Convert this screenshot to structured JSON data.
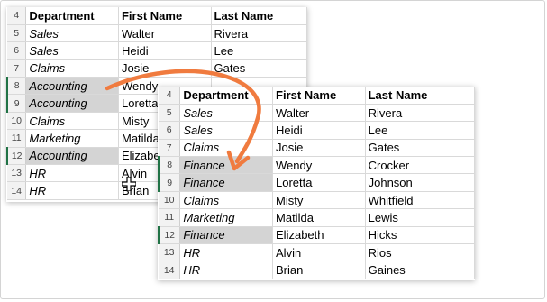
{
  "headers": [
    "Department",
    "First Name",
    "Last Name"
  ],
  "before": {
    "rows": [
      {
        "num": "5",
        "dept": "Sales",
        "first": "Walter",
        "last": "Rivera",
        "hl": false
      },
      {
        "num": "6",
        "dept": "Sales",
        "first": "Heidi",
        "last": "Lee",
        "hl": false
      },
      {
        "num": "7",
        "dept": "Claims",
        "first": "Josie",
        "last": "Gates",
        "hl": false
      },
      {
        "num": "8",
        "dept": "Accounting",
        "first": "Wendy",
        "last": "",
        "hl": true
      },
      {
        "num": "9",
        "dept": "Accounting",
        "first": "Loretta",
        "last": "",
        "hl": true
      },
      {
        "num": "10",
        "dept": "Claims",
        "first": "Misty",
        "last": "",
        "hl": false
      },
      {
        "num": "11",
        "dept": "Marketing",
        "first": "Matilda",
        "last": "",
        "hl": false
      },
      {
        "num": "12",
        "dept": "Accounting",
        "first": "Elizabeth",
        "last": "",
        "hl": true
      },
      {
        "num": "13",
        "dept": "HR",
        "first": "Alvin",
        "last": "",
        "hl": false
      },
      {
        "num": "14",
        "dept": "HR",
        "first": "Brian",
        "last": "",
        "hl": false
      }
    ]
  },
  "after": {
    "rows": [
      {
        "num": "5",
        "dept": "Sales",
        "first": "Walter",
        "last": "Rivera",
        "hl": false
      },
      {
        "num": "6",
        "dept": "Sales",
        "first": "Heidi",
        "last": "Lee",
        "hl": false
      },
      {
        "num": "7",
        "dept": "Claims",
        "first": "Josie",
        "last": "Gates",
        "hl": false
      },
      {
        "num": "8",
        "dept": "Finance",
        "first": "Wendy",
        "last": "Crocker",
        "hl": true
      },
      {
        "num": "9",
        "dept": "Finance",
        "first": "Loretta",
        "last": "Johnson",
        "hl": true
      },
      {
        "num": "10",
        "dept": "Claims",
        "first": "Misty",
        "last": "Whitfield",
        "hl": false
      },
      {
        "num": "11",
        "dept": "Marketing",
        "first": "Matilda",
        "last": "Lewis",
        "hl": false
      },
      {
        "num": "12",
        "dept": "Finance",
        "first": "Elizabeth",
        "last": "Hicks",
        "hl": true
      },
      {
        "num": "13",
        "dept": "HR",
        "first": "Alvin",
        "last": "Rios",
        "hl": false
      },
      {
        "num": "14",
        "dept": "HR",
        "first": "Brian",
        "last": "Gaines",
        "hl": false
      }
    ]
  },
  "header_row_num": "4",
  "colors": {
    "highlight": "#d4d4d4",
    "arrow": "#f07b3f",
    "selection": "#217346"
  },
  "icons": {
    "cursor": "cross-cursor-icon",
    "arrow": "curved-arrow-icon"
  }
}
